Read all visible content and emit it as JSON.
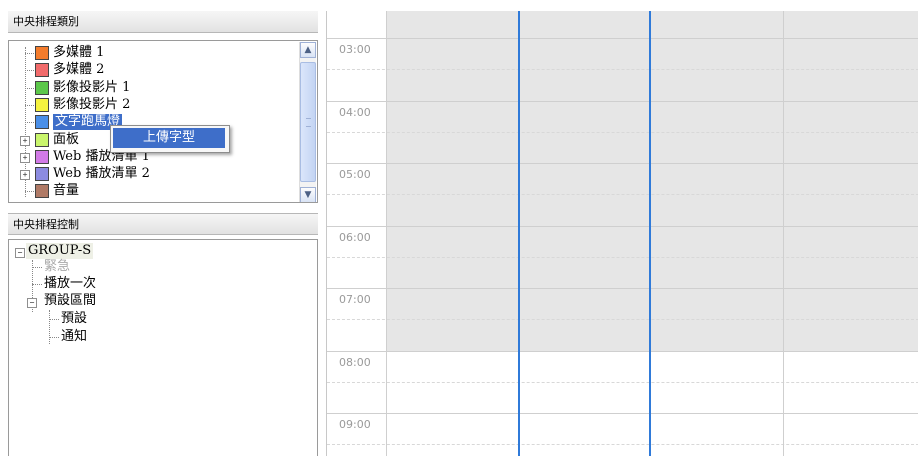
{
  "category_panel": {
    "title": "中央排程類別",
    "items": [
      {
        "label": "多媒體 1",
        "color": "#f47c2c"
      },
      {
        "label": "多媒體 2",
        "color": "#f26b6b"
      },
      {
        "label": "影像投影片 1",
        "color": "#5cc74a"
      },
      {
        "label": "影像投影片 2",
        "color": "#f5f23f"
      },
      {
        "label": "文字跑馬燈",
        "color": "#4a8fe8",
        "selected": true
      },
      {
        "label": "面板",
        "color": "#c9f56c",
        "expandable": true
      },
      {
        "label": "Web 播放清單 1",
        "color": "#d27ae6",
        "expandable": true
      },
      {
        "label": "Web 播放清單 2",
        "color": "#8c8be0",
        "expandable": true
      },
      {
        "label": "音量",
        "color": "#b07a66"
      }
    ],
    "context_menu": {
      "item": "上傳字型"
    }
  },
  "control_panel": {
    "title": "中央排程控制",
    "group": "GROUP-S",
    "items": [
      {
        "label": "緊急",
        "disabled": true
      },
      {
        "label": "播放一次"
      },
      {
        "label": "預設區間",
        "children": [
          "預設",
          "通知"
        ]
      }
    ]
  },
  "calendar": {
    "times": [
      "03:00",
      "04:00",
      "05:00",
      "06:00",
      "07:00",
      "08:00",
      "09:00"
    ],
    "shaded_hours": 5,
    "colors": {
      "shade": "#e6e6e6",
      "marker": "#2f7ad9"
    }
  }
}
